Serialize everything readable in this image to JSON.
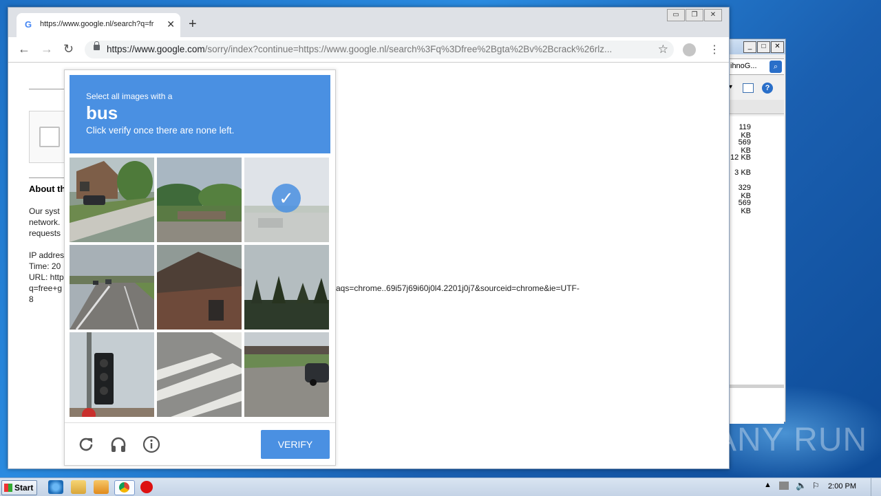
{
  "browser": {
    "tab_title": "https://www.google.nl/search?q=fr",
    "new_tab": "+",
    "close_tab": "✕",
    "url_domain": "https://www.google.com",
    "url_path": "/sorry/index?continue=https://www.google.nl/search%3Fq%3Dfree%2Bgta%2Bv%2Bcrack%26rlz...",
    "window_minimize": "▭",
    "window_restore": "❐",
    "window_close": "✕"
  },
  "page": {
    "about_heading": "About th",
    "lines": [
      "Our syst",
      "network.",
      "requests"
    ],
    "ip_label": "IP addres",
    "time_label": "Time: 20",
    "url_label": "URL: http",
    "url_cont": "q=free+g",
    "url_tail": "aqs=chrome..69i57j69i60j0l4.2201j0j7&sourceid=chrome&ie=UTF-",
    "url_last": "8"
  },
  "captcha": {
    "prompt_small": "Select all images with a",
    "target": "bus",
    "instruction": "Click verify once there are none left.",
    "verify_label": "VERIFY",
    "selected_tiles": [
      2
    ]
  },
  "explorer": {
    "address": "ihnoG...",
    "sizes": [
      "119 KB",
      "569 KB",
      "12 KB",
      "3 KB",
      "329 KB",
      "569 KB"
    ]
  },
  "watermark": "ANY RUN",
  "taskbar": {
    "start_label": "Start",
    "clock": "2:00 PM"
  }
}
